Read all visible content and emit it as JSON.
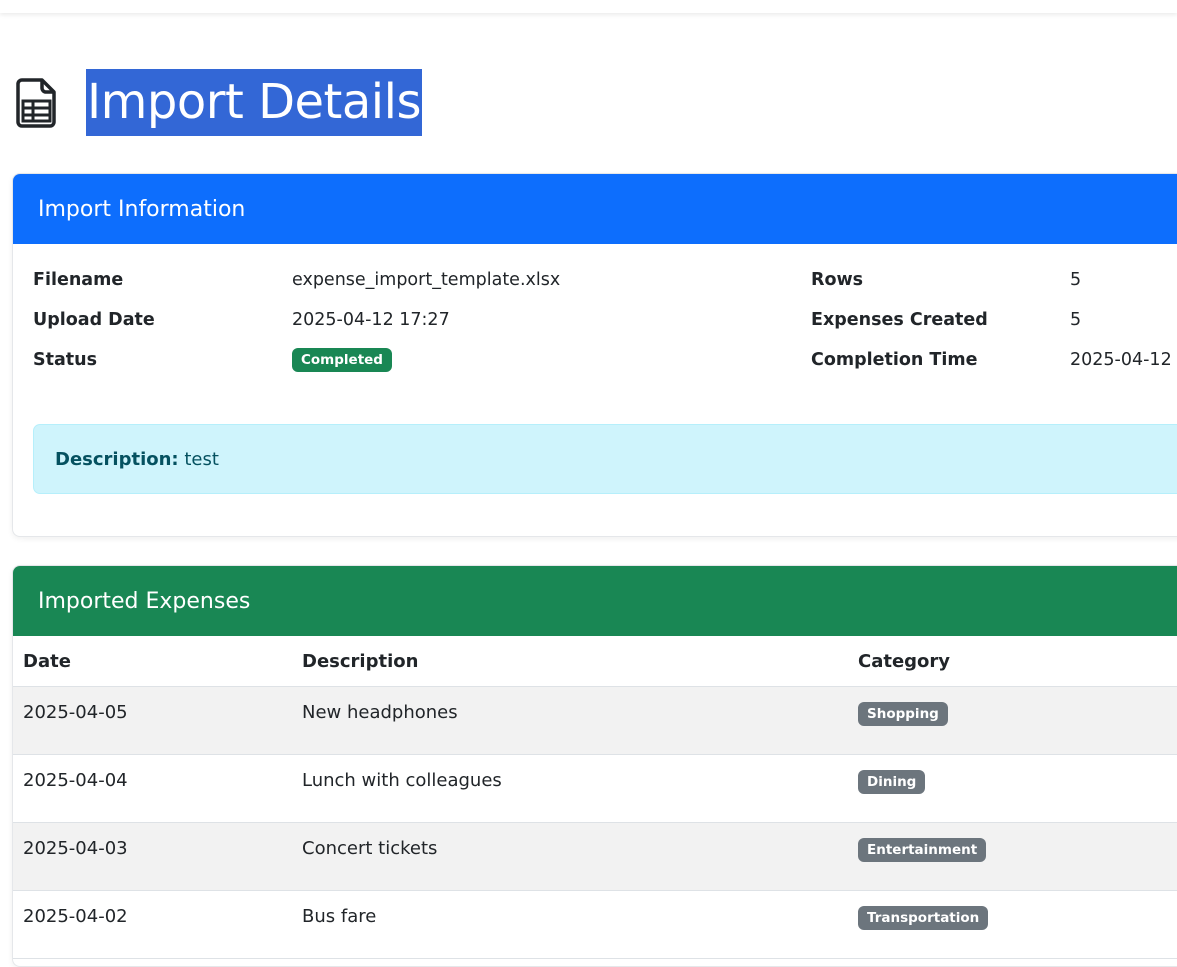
{
  "page": {
    "title": "Import Details",
    "icon": "file-spreadsheet-icon"
  },
  "import_info": {
    "header": "Import Information",
    "fields_left": [
      {
        "label": "Filename",
        "value": "expense_import_template.xlsx"
      },
      {
        "label": "Upload Date",
        "value": "2025-04-12 17:27"
      },
      {
        "label": "Status",
        "value": "Completed"
      }
    ],
    "fields_right": [
      {
        "label": "Rows",
        "value": "5"
      },
      {
        "label": "Expenses Created",
        "value": "5"
      },
      {
        "label": "Completion Time",
        "value": "2025-04-12"
      }
    ],
    "description_label": "Description:",
    "description_value": "test",
    "colors": {
      "header": "#0d6efd",
      "status_badge": "#198754",
      "alert_bg": "#cff4fc"
    }
  },
  "expenses": {
    "header": "Imported Expenses",
    "columns": [
      "Date",
      "Description",
      "Category"
    ],
    "rows": [
      {
        "date": "2025-04-05",
        "description": "New headphones",
        "category": "Shopping"
      },
      {
        "date": "2025-04-04",
        "description": "Lunch with colleagues",
        "category": "Dining"
      },
      {
        "date": "2025-04-03",
        "description": "Concert tickets",
        "category": "Entertainment"
      },
      {
        "date": "2025-04-02",
        "description": "Bus fare",
        "category": "Transportation"
      }
    ],
    "colors": {
      "header": "#198754",
      "category_badge": "#6c757d"
    }
  }
}
